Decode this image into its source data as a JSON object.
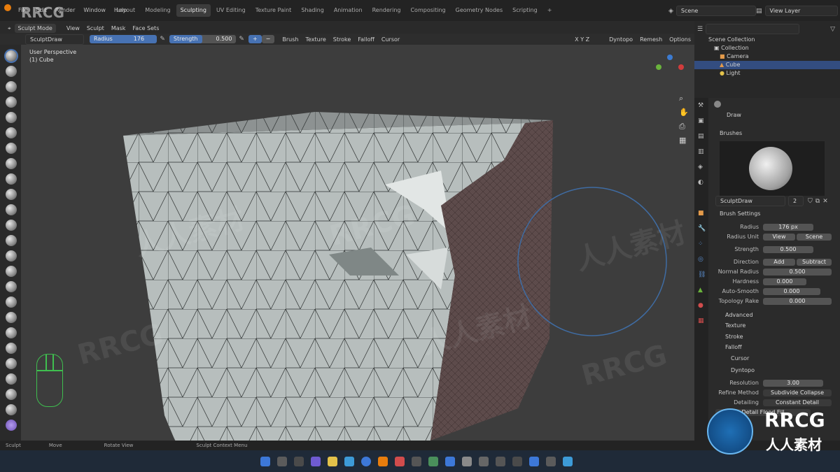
{
  "topbar": {
    "menus": [
      "File",
      "Edit",
      "Render",
      "Window",
      "Help"
    ],
    "workspaces": [
      "Layout",
      "Modeling",
      "Sculpting",
      "UV Editing",
      "Texture Paint",
      "Shading",
      "Animation",
      "Rendering",
      "Compositing",
      "Geometry Nodes",
      "Scripting"
    ],
    "active_workspace": "Sculpting",
    "scene_label": "Scene",
    "viewlayer_label": "View Layer"
  },
  "vheader": {
    "mode": "Sculpt Mode",
    "menus": [
      "View",
      "Sculpt",
      "Mask",
      "Face Sets"
    ]
  },
  "toolbar": {
    "brush_name": "SculptDraw",
    "radius_label": "Radius",
    "radius_value": "176 px",
    "strength_label": "Strength",
    "strength_value": "0.500",
    "dropdowns": [
      "Brush",
      "Texture",
      "Stroke",
      "Falloff",
      "Cursor"
    ],
    "axes": "X Y Z",
    "dyntopo": "Dyntopo",
    "remesh": "Remesh",
    "options": "Options"
  },
  "viewport": {
    "perspective": "User Perspective",
    "object": "(1) Cube"
  },
  "outliner": {
    "title": "Scene Collection",
    "items": [
      {
        "label": "Collection",
        "selected": false
      },
      {
        "label": "Camera",
        "selected": false
      },
      {
        "label": "Cube",
        "selected": true
      },
      {
        "label": "Light",
        "selected": false
      }
    ]
  },
  "properties": {
    "brush_header": "Draw",
    "brushes_section": "Brushes",
    "brush_name": "SculptDraw",
    "brush_users": "2",
    "brush_settings_section": "Brush Settings",
    "radius_label": "Radius",
    "radius_value": "176 px",
    "radius_unit_label": "Radius Unit",
    "radius_unit_view": "View",
    "radius_unit_scene": "Scene",
    "strength_label": "Strength",
    "strength_value": "0.500",
    "direction_label": "Direction",
    "direction_add": "Add",
    "direction_subtract": "Subtract",
    "normal_radius_label": "Normal Radius",
    "normal_radius_value": "0.500",
    "hardness_label": "Hardness",
    "hardness_value": "0.000",
    "auto_smooth_label": "Auto-Smooth",
    "auto_smooth_value": "0.000",
    "topology_rake_label": "Topology Rake",
    "topology_rake_value": "0.000",
    "sections": [
      "Advanced",
      "Texture",
      "Stroke",
      "Falloff",
      "Cursor"
    ],
    "dyntopo_section": "Dyntopo",
    "resolution_label": "Resolution",
    "resolution_value": "3.00",
    "refine_label": "Refine Method",
    "refine_value": "Subdivide Collapse",
    "detailing_label": "Detailing",
    "detailing_value": "Constant Detail",
    "detail_flood": "Detail Flood Fill"
  },
  "statusbar": {
    "items": [
      "Sculpt",
      "Move",
      "Rotate View",
      "Sculpt Context Menu"
    ]
  },
  "watermark": {
    "brand": "RRCG",
    "cn": "人人素材"
  },
  "colors": {
    "accent": "#4772b3",
    "selection": "#334d80"
  }
}
